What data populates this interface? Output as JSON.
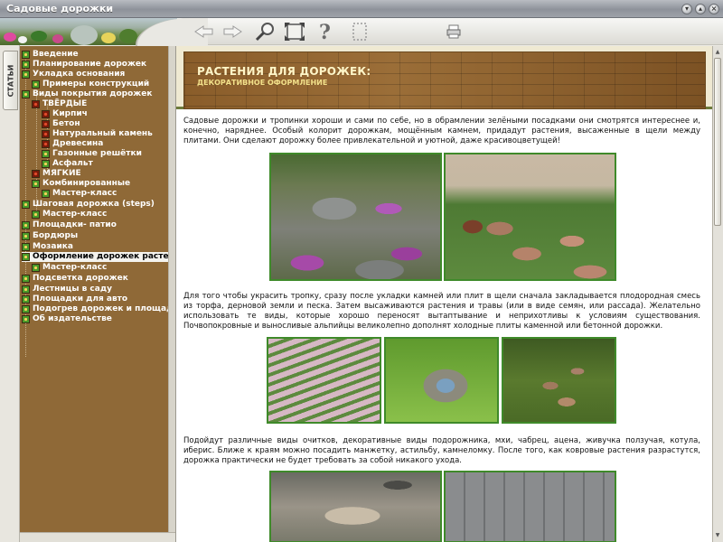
{
  "window": {
    "title": "Садовые дорожки"
  },
  "toolbar": {
    "buttons": [
      {
        "icon": "back-arrow-icon"
      },
      {
        "icon": "forward-arrow-icon"
      },
      {
        "icon": "magnifier-icon"
      },
      {
        "icon": "fit-page-icon"
      },
      {
        "icon": "help-icon"
      },
      {
        "icon": "select-frame-icon"
      },
      {
        "icon": "printer-icon"
      }
    ]
  },
  "sidebar": {
    "tab_label": "СТАТЬИ",
    "items": [
      {
        "label": "Введение",
        "level": 0
      },
      {
        "label": "Планирование дорожек",
        "level": 0
      },
      {
        "label": "Укладка основания",
        "level": 0
      },
      {
        "label": "Примеры конструкций",
        "level": 1
      },
      {
        "label": "Виды покрытия дорожек",
        "level": 0
      },
      {
        "label": "ТВЁРДЫЕ",
        "level": 1
      },
      {
        "label": "Кирпич",
        "level": 2
      },
      {
        "label": "Бетон",
        "level": 2
      },
      {
        "label": "Натуральный камень",
        "level": 2
      },
      {
        "label": "Древесина",
        "level": 2
      },
      {
        "label": "Газонные решётки",
        "level": 2
      },
      {
        "label": "Асфальт",
        "level": 2
      },
      {
        "label": "МЯГКИЕ",
        "level": 1
      },
      {
        "label": "Комбинированные",
        "level": 1
      },
      {
        "label": "Мастер-класс",
        "level": 2
      },
      {
        "label": "Шаговая дорожка (steps)",
        "level": 0
      },
      {
        "label": "Мастер-класс",
        "level": 1
      },
      {
        "label": "Площадки- патио",
        "level": 0
      },
      {
        "label": "Бордюры",
        "level": 0
      },
      {
        "label": "Мозаика",
        "level": 0
      },
      {
        "label": "Оформление дорожек растениями",
        "level": 0,
        "selected": true
      },
      {
        "label": "Мастер-класс",
        "level": 1
      },
      {
        "label": "Подсветка дорожек",
        "level": 0
      },
      {
        "label": "Лестницы в саду",
        "level": 0
      },
      {
        "label": "Площадки для авто",
        "level": 0
      },
      {
        "label": "Подогрев дорожек и площадок",
        "level": 0
      },
      {
        "label": "Об издательстве",
        "level": 0
      }
    ]
  },
  "article": {
    "title": "РАСТЕНИЯ ДЛЯ ДОРОЖЕК:",
    "subtitle": "ДЕКОРАТИВНОЕ ОФОРМЛЕНИЕ",
    "paragraphs": [
      "Садовые дорожки и тропинки хороши и сами по себе, но в обрамлении зелёными посадками они смотрятся интереснее и, конечно, наряднее. Особый колорит дорожкам, мощённым камнем, придадут растения, высаженные в щели между плитами. Они сделают дорожку более привлекательной и уютной, даже красивоцветущей!",
      "Для того чтобы украсить тропку, сразу после укладки камней или плит в щели сначала закладывается плодородная смесь из торфа, дерновой земли и песка. Затем высаживаются растения и травы (или в виде семян, или рассада). Желательно использовать те виды, которые хорошо переносят вытаптывание и неприхотливы к условиям существования. Почвопокровные и выносливые альпийцы великолепно дополнят холодные плиты каменной или бетонной дорожки.",
      "Подойдут различные виды очитков, декоративные виды подорожника, мхи, чабрец, ацена, живучка ползучая, котула, иберис. Ближе к краям можно посадить манжетку, астильбу, камнеломку. После того, как ковровые растения разрастутся, дорожка практически не будет требовать за собой никакого ухода."
    ]
  },
  "colors": {
    "sidebar_bg": "#8f6937",
    "banner_title": "#fff6c8",
    "banner_subtitle": "#f2e08a",
    "photo_border": "#3f8a2a"
  }
}
